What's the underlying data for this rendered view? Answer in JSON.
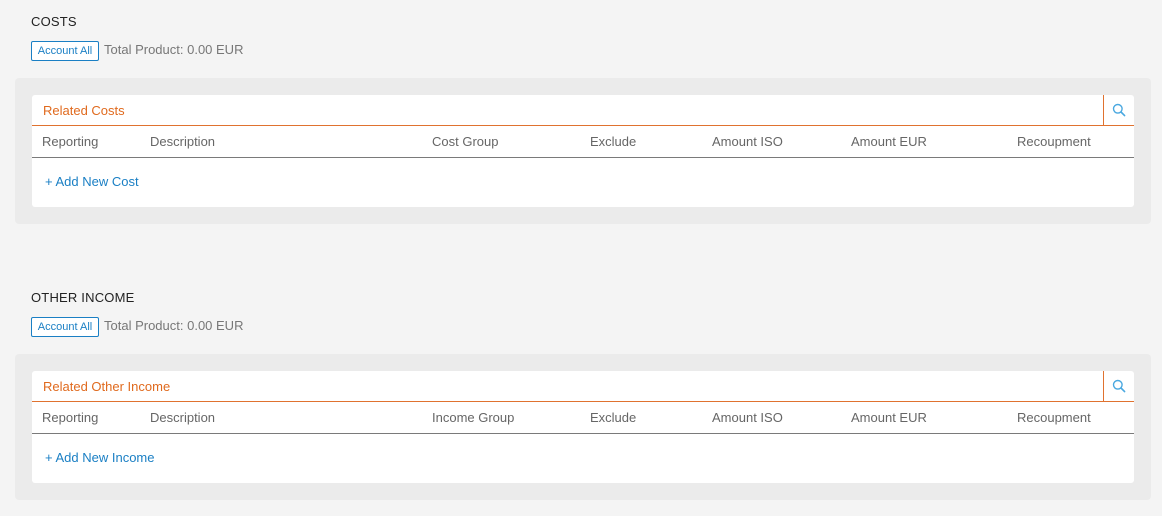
{
  "costs": {
    "title": "COSTS",
    "account_all_label": "Account All",
    "total_text": "Total Product: 0.00 EUR",
    "card_title": "Related Costs",
    "columns": [
      "Reporting",
      "Description",
      "Cost Group",
      "Exclude",
      "Amount ISO",
      "Amount EUR",
      "Recoupment"
    ],
    "add_label": "+ Add New Cost"
  },
  "other_income": {
    "title": "OTHER INCOME",
    "account_all_label": "Account All",
    "total_text": "Total Product: 0.00 EUR",
    "card_title": "Related Other Income",
    "columns": [
      "Reporting",
      "Description",
      "Income Group",
      "Exclude",
      "Amount ISO",
      "Amount EUR",
      "Recoupment"
    ],
    "add_label": "+ Add New Income"
  },
  "colors": {
    "accent_orange": "#e06a1e",
    "link_blue": "#1a7fc4"
  },
  "icons": {
    "search": "search-icon"
  }
}
